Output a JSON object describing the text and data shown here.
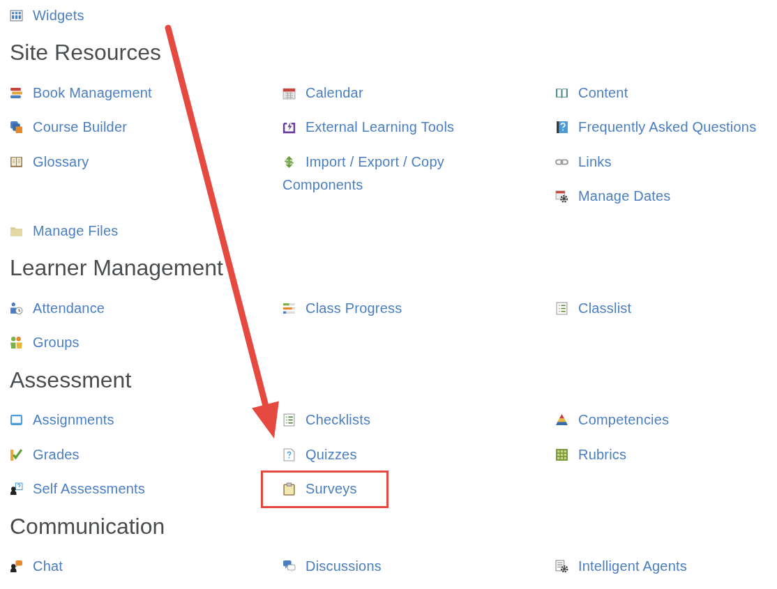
{
  "top_items": [
    {
      "label": "Widgets",
      "highlighted": false
    }
  ],
  "sections": [
    {
      "title": "Site Resources",
      "items": [
        {
          "label": "Book Management",
          "highlighted": false
        },
        {
          "label": "Calendar",
          "highlighted": false
        },
        {
          "label": "Content",
          "highlighted": false
        },
        {
          "label": "Course Builder",
          "highlighted": false
        },
        {
          "label": "External Learning Tools",
          "highlighted": false
        },
        {
          "label": "Frequently Asked Questions",
          "highlighted": false
        },
        {
          "label": "Glossary",
          "highlighted": false
        },
        {
          "label": "Import / Export / Copy Components",
          "highlighted": false
        },
        {
          "label": "Links",
          "highlighted": false
        },
        {
          "label": "Manage Dates",
          "highlighted": false
        },
        {
          "label": "Manage Files",
          "highlighted": false
        }
      ]
    },
    {
      "title": "Learner Management",
      "items": [
        {
          "label": "Attendance",
          "highlighted": false
        },
        {
          "label": "Class Progress",
          "highlighted": false
        },
        {
          "label": "Classlist",
          "highlighted": false
        },
        {
          "label": "Groups",
          "highlighted": false
        }
      ]
    },
    {
      "title": "Assessment",
      "items": [
        {
          "label": "Assignments",
          "highlighted": false
        },
        {
          "label": "Checklists",
          "highlighted": false
        },
        {
          "label": "Competencies",
          "highlighted": false
        },
        {
          "label": "Grades",
          "highlighted": false
        },
        {
          "label": "Quizzes",
          "highlighted": false
        },
        {
          "label": "Rubrics",
          "highlighted": false
        },
        {
          "label": "Self Assessments",
          "highlighted": false
        },
        {
          "label": "Surveys",
          "highlighted": true
        }
      ]
    },
    {
      "title": "Communication",
      "items": [
        {
          "label": "Chat",
          "highlighted": false
        },
        {
          "label": "Discussions",
          "highlighted": false
        },
        {
          "label": "Intelligent Agents",
          "highlighted": false
        }
      ]
    }
  ]
}
